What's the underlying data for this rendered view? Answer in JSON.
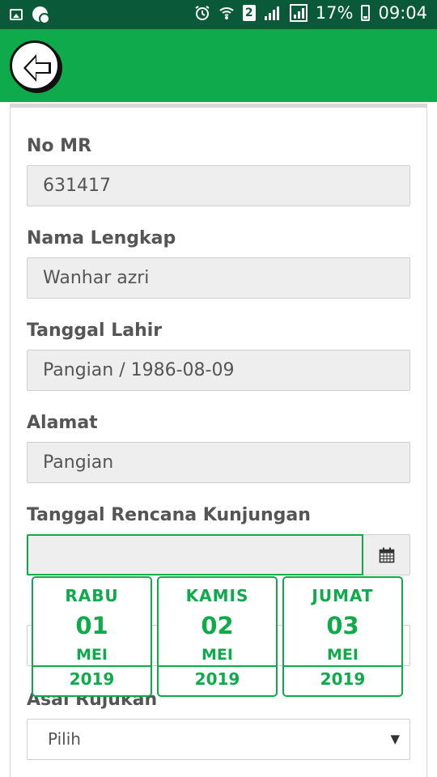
{
  "status_bar": {
    "sim_badge": "2",
    "battery": "17%",
    "time": "09:04"
  },
  "appbar": {
    "back_icon": "arrow-left-icon"
  },
  "form": {
    "no_mr": {
      "label": "No MR",
      "value": "631417"
    },
    "nama_lengkap": {
      "label": "Nama Lengkap",
      "value": "Wanhar azri"
    },
    "tanggal_lahir": {
      "label": "Tanggal Lahir",
      "value": "Pangian / 1986-08-09"
    },
    "alamat": {
      "label": "Alamat",
      "value": "Pangian"
    },
    "tanggal_rencana": {
      "label": "Tanggal Rencana Kunjungan",
      "value": "",
      "icon": "calendar-icon"
    },
    "asal_rujukan": {
      "label": "Asal Rujukan",
      "selected": "Pilih"
    }
  },
  "date_options": [
    {
      "day": "RABU",
      "date": "01",
      "month": "MEI",
      "year": "2019"
    },
    {
      "day": "KAMIS",
      "date": "02",
      "month": "MEI",
      "year": "2019"
    },
    {
      "day": "JUMAT",
      "date": "03",
      "month": "MEI",
      "year": "2019"
    }
  ],
  "colors": {
    "status_bar": "#0a5a3a",
    "appbar": "#0faa4b",
    "accent": "#0faa4b"
  }
}
